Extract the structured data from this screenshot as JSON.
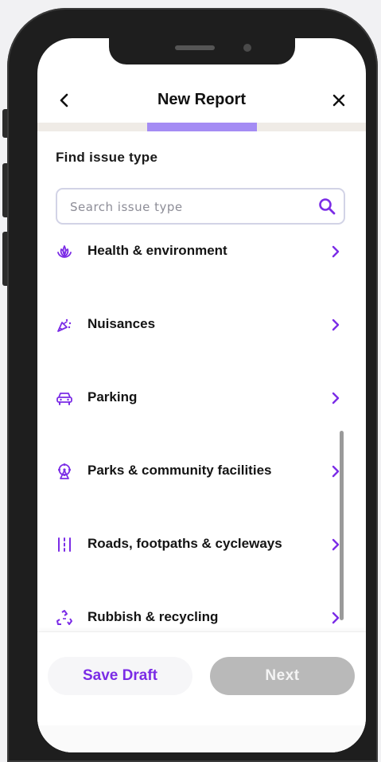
{
  "header": {
    "title": "New Report"
  },
  "progress": {
    "fraction": 0.333
  },
  "section": {
    "label": "Find issue type"
  },
  "search": {
    "placeholder": "Search issue type",
    "value": ""
  },
  "issue_types": [
    {
      "label": "Health & environment",
      "icon": "lotus-icon"
    },
    {
      "label": "Nuisances",
      "icon": "party-popper-icon"
    },
    {
      "label": "Parking",
      "icon": "car-icon"
    },
    {
      "label": "Parks & community facilities",
      "icon": "ferris-wheel-icon"
    },
    {
      "label": "Roads, footpaths & cycleways",
      "icon": "road-lanes-icon"
    },
    {
      "label": "Rubbish & recycling",
      "icon": "recycle-icon"
    }
  ],
  "footer": {
    "save_draft_label": "Save Draft",
    "next_label": "Next"
  },
  "colors": {
    "accent": "#7b2ce6",
    "progress": "#a48cf4",
    "disabled": "#b9b9b9"
  }
}
